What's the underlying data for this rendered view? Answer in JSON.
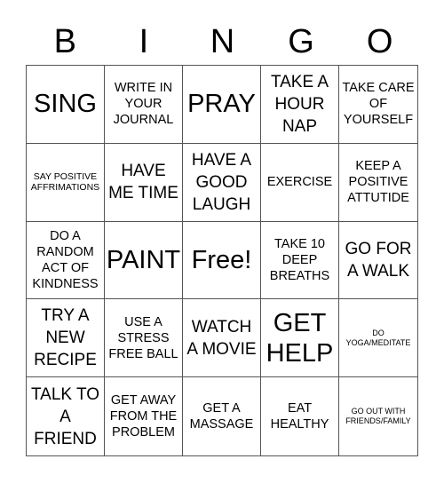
{
  "header": {
    "letters": [
      "B",
      "I",
      "N",
      "G",
      "O"
    ]
  },
  "cells": [
    {
      "text": "SING",
      "size": "s-xl"
    },
    {
      "text": "WRITE IN YOUR JOURNAL",
      "size": "s-md"
    },
    {
      "text": "PRAY",
      "size": "s-xl"
    },
    {
      "text": "TAKE A HOUR NAP",
      "size": "s-lg"
    },
    {
      "text": "TAKE CARE OF YOURSELF",
      "size": "s-md"
    },
    {
      "text": "SAY POSITIVE AFFRIMATIONS",
      "size": "s-sm"
    },
    {
      "text": "HAVE ME TIME",
      "size": "s-lg"
    },
    {
      "text": "HAVE A GOOD LAUGH",
      "size": "s-lg"
    },
    {
      "text": "EXERCISE",
      "size": "s-md"
    },
    {
      "text": "KEEP A POSITIVE ATTUTIDE",
      "size": "s-md"
    },
    {
      "text": "DO A RANDOM ACT OF KINDNESS",
      "size": "s-md"
    },
    {
      "text": "PAINT",
      "size": "s-xl"
    },
    {
      "text": "Free!",
      "size": "s-xxl"
    },
    {
      "text": "TAKE 10 DEEP BREATHS",
      "size": "s-md"
    },
    {
      "text": "GO FOR A WALK",
      "size": "s-lg"
    },
    {
      "text": "TRY A NEW RECIPE",
      "size": "s-lg"
    },
    {
      "text": "USE A STRESS FREE BALL",
      "size": "s-md"
    },
    {
      "text": "WATCH A MOVIE",
      "size": "s-lg"
    },
    {
      "text": "GET HELP",
      "size": "s-xl"
    },
    {
      "text": "DO YOGA/MEDITATE",
      "size": "s-xs"
    },
    {
      "text": "TALK TO A FRIEND",
      "size": "s-lg"
    },
    {
      "text": "GET AWAY FROM THE PROBLEM",
      "size": "s-md"
    },
    {
      "text": "GET A MASSAGE",
      "size": "s-md"
    },
    {
      "text": "EAT HEALTHY",
      "size": "s-md"
    },
    {
      "text": "GO OUT WITH FRIENDS/FAMILY",
      "size": "s-xs"
    }
  ]
}
